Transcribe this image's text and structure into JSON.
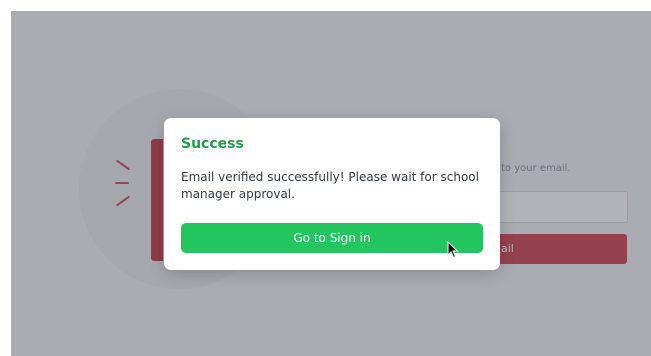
{
  "background": {
    "hint_text": "to your email.",
    "button_label": "ail"
  },
  "modal": {
    "title": "Success",
    "message": "Email verified successfully! Please wait for school manager approval.",
    "button_label": "Go to Sign in",
    "accent_color": "#22c55e",
    "title_color": "#1f9d4b"
  },
  "cursor": {
    "icon": "arrow-cursor-icon"
  }
}
